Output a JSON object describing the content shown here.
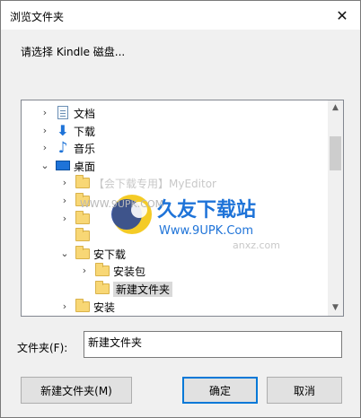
{
  "window": {
    "title": "浏览文件夹"
  },
  "prompt": "请选择 Kindle 磁盘...",
  "tree": {
    "items": [
      {
        "label": "文档",
        "icon": "documents-icon",
        "expander": "collapsed",
        "level": 1
      },
      {
        "label": "下载",
        "icon": "downloads-icon",
        "expander": "collapsed",
        "level": 1
      },
      {
        "label": "音乐",
        "icon": "music-icon",
        "expander": "collapsed",
        "level": 1
      },
      {
        "label": "桌面",
        "icon": "desktop-icon",
        "expander": "expanded",
        "level": 1
      },
      {
        "label": "【会下载专用】MyEditor",
        "icon": "folder-icon",
        "expander": "collapsed",
        "level": 2
      },
      {
        "label": "",
        "icon": "folder-icon",
        "expander": "collapsed",
        "level": 2
      },
      {
        "label": "",
        "icon": "folder-icon",
        "expander": "collapsed",
        "level": 2
      },
      {
        "label": "",
        "icon": "folder-icon",
        "expander": "none",
        "level": 2
      },
      {
        "label": "安下载",
        "icon": "folder-icon",
        "expander": "expanded",
        "level": 2
      },
      {
        "label": "安装包",
        "icon": "folder-icon",
        "expander": "collapsed",
        "level": 3
      },
      {
        "label": "新建文件夹",
        "icon": "folder-icon",
        "expander": "none",
        "level": 3,
        "selected": true
      },
      {
        "label": "安装",
        "icon": "folder-icon",
        "expander": "collapsed",
        "level": 2
      }
    ]
  },
  "watermark": {
    "brand": "久友下载站",
    "url": "Www.9UPK.Com",
    "left_text": "WWW.9UPK.COM",
    "right_text": "anxz.com"
  },
  "folder_field": {
    "label": "文件夹(F):",
    "value": "新建文件夹"
  },
  "buttons": {
    "new_folder": "新建文件夹(M)",
    "ok": "确定",
    "cancel": "取消"
  },
  "colors": {
    "accent": "#0078d7",
    "selection": "#d9d9d9"
  }
}
